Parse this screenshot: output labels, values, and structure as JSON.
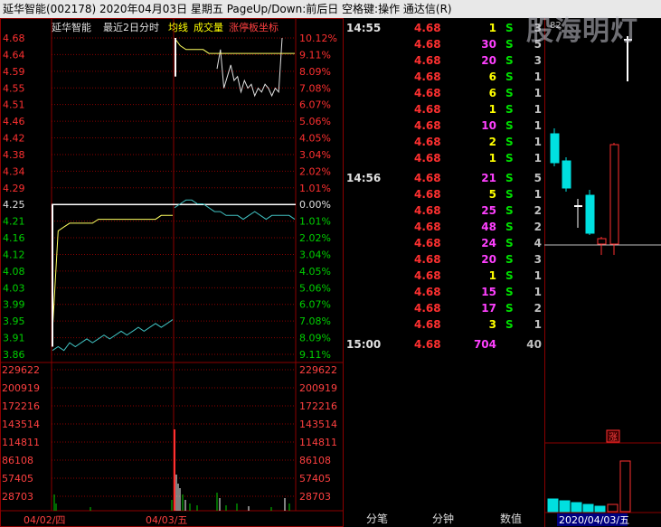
{
  "title": "延华智能(002178)   2020年04月03日  星期五  PageUp/Down:前后日  空格键:操作  通达信(R)",
  "chart_header": {
    "name": "延华智能",
    "mode": "最近2日分时",
    "legend": [
      {
        "label": "均线",
        "color": "#ffff00"
      },
      {
        "label": "成交量",
        "color": "#ffff00"
      },
      {
        "label": "涨停板坐标",
        "color": "#ff4040"
      }
    ]
  },
  "watermark": "股海明灯",
  "colors": {
    "up": "#ff3030",
    "down": "#00e0e0",
    "grid": "#8b0000",
    "price_line": "#40c0c0",
    "avg_line": "#ffff60",
    "volume": "#ffff00",
    "magenta": "#ff40ff"
  },
  "chart_data": [
    {
      "type": "line",
      "subtitle": "最近2日分时",
      "y_price_ticks": [
        "4.68",
        "4.64",
        "4.59",
        "4.55",
        "4.51",
        "4.46",
        "4.42",
        "4.38",
        "4.34",
        "4.29",
        "4.25",
        "4.21",
        "4.16",
        "4.12",
        "4.08",
        "4.03",
        "3.99",
        "3.95",
        "3.91",
        "3.86"
      ],
      "y_pct_ticks": [
        "10.12%",
        "9.11%",
        "8.09%",
        "7.08%",
        "6.07%",
        "5.06%",
        "4.05%",
        "3.04%",
        "2.02%",
        "1.01%",
        "0.00%",
        "1.01%",
        "2.02%",
        "3.04%",
        "4.05%",
        "5.06%",
        "6.07%",
        "7.08%",
        "8.09%",
        "9.11%"
      ],
      "ylim": [
        3.86,
        4.68
      ],
      "x_day_labels": [
        "04/02/四",
        "04/03/五"
      ],
      "prev_close": 4.25,
      "series": [
        {
          "name": "",
          "day": "04/02",
          "values": [
            3.87,
            3.88,
            3.87,
            3.89,
            3.88,
            3.89,
            3.9,
            3.89,
            3.9,
            3.91,
            3.9,
            3.91,
            3.92,
            3.91,
            3.92,
            3.93,
            3.92,
            3.93,
            3.94,
            3.93,
            3.94,
            3.95
          ]
        },
        {
          "name": "均线",
          "day": "04/02",
          "values": [
            3.92,
            4.18,
            4.19,
            4.2,
            4.2,
            4.2,
            4.2,
            4.2,
            4.21,
            4.21,
            4.21,
            4.21,
            4.21,
            4.21,
            4.21,
            4.21,
            4.21,
            4.21,
            4.21,
            4.22,
            4.22,
            4.22
          ]
        },
        {
          "name": "",
          "day": "04/03",
          "values": [
            4.24,
            4.25,
            4.26,
            4.26,
            4.25,
            4.25,
            4.24,
            4.23,
            4.23,
            4.22,
            4.22,
            4.22,
            4.21,
            4.22,
            4.23,
            4.22,
            4.21,
            4.22,
            4.22,
            4.22,
            4.22,
            4.21
          ]
        },
        {
          "name": "均线",
          "day": "04/03",
          "values": [
            4.68,
            4.66,
            4.65,
            4.65,
            4.65,
            4.65,
            4.64,
            4.64,
            4.64,
            4.64,
            4.64,
            4.64,
            4.64,
            4.64,
            4.64,
            4.64,
            4.64,
            4.64,
            4.64,
            4.64,
            4.64,
            4.64
          ]
        },
        {
          "name": "",
          "day": "04/03 upper",
          "values": [
            4.6,
            4.65,
            4.55,
            4.58,
            4.61,
            4.57,
            4.58,
            4.54,
            4.57,
            4.55,
            4.56,
            4.53,
            4.55,
            4.54,
            4.56,
            4.55,
            4.53,
            4.55,
            4.54,
            4.68
          ]
        }
      ],
      "volume_ticks": [
        "229622",
        "200919",
        "172216",
        "143514",
        "114811",
        "86108",
        "57405",
        "28703"
      ],
      "volume_max": 229622
    },
    {
      "type": "bar",
      "subtitle": "daily candles",
      "top_label": "82",
      "x_date_label": "2020/04/03/五",
      "limit_badge": "涨"
    }
  ],
  "ticks": [
    {
      "time": "14:55",
      "price": "4.68",
      "vol": "1",
      "side": "S",
      "n": "3",
      "volc": "yellow"
    },
    {
      "time": "",
      "price": "4.68",
      "vol": "30",
      "side": "S",
      "n": "5",
      "volc": "magenta"
    },
    {
      "time": "",
      "price": "4.68",
      "vol": "20",
      "side": "S",
      "n": "3",
      "volc": "magenta"
    },
    {
      "time": "",
      "price": "4.68",
      "vol": "6",
      "side": "S",
      "n": "1",
      "volc": "yellow"
    },
    {
      "time": "",
      "price": "4.68",
      "vol": "6",
      "side": "S",
      "n": "1",
      "volc": "yellow"
    },
    {
      "time": "",
      "price": "4.68",
      "vol": "1",
      "side": "S",
      "n": "1",
      "volc": "yellow"
    },
    {
      "time": "",
      "price": "4.68",
      "vol": "10",
      "side": "S",
      "n": "1",
      "volc": "magenta"
    },
    {
      "time": "",
      "price": "4.68",
      "vol": "2",
      "side": "S",
      "n": "1",
      "volc": "yellow"
    },
    {
      "time": "",
      "price": "4.68",
      "vol": "1",
      "side": "S",
      "n": "1",
      "volc": "yellow"
    },
    {
      "time": "14:56",
      "price": "4.68",
      "vol": "21",
      "side": "S",
      "n": "5",
      "volc": "magenta"
    },
    {
      "time": "",
      "price": "4.68",
      "vol": "5",
      "side": "S",
      "n": "1",
      "volc": "yellow"
    },
    {
      "time": "",
      "price": "4.68",
      "vol": "25",
      "side": "S",
      "n": "2",
      "volc": "magenta"
    },
    {
      "time": "",
      "price": "4.68",
      "vol": "48",
      "side": "S",
      "n": "2",
      "volc": "magenta"
    },
    {
      "time": "",
      "price": "4.68",
      "vol": "24",
      "side": "S",
      "n": "4",
      "volc": "magenta"
    },
    {
      "time": "",
      "price": "4.68",
      "vol": "20",
      "side": "S",
      "n": "3",
      "volc": "magenta"
    },
    {
      "time": "",
      "price": "4.68",
      "vol": "1",
      "side": "S",
      "n": "1",
      "volc": "yellow"
    },
    {
      "time": "",
      "price": "4.68",
      "vol": "15",
      "side": "S",
      "n": "1",
      "volc": "magenta"
    },
    {
      "time": "",
      "price": "4.68",
      "vol": "17",
      "side": "S",
      "n": "2",
      "volc": "magenta"
    },
    {
      "time": "",
      "price": "4.68",
      "vol": "3",
      "side": "S",
      "n": "1",
      "volc": "yellow"
    },
    {
      "time": "15:00",
      "price": "4.68",
      "vol": "704",
      "side": "",
      "n": "40",
      "volc": "magenta"
    }
  ],
  "tabs": [
    "分笔",
    "分钟",
    "数值"
  ]
}
